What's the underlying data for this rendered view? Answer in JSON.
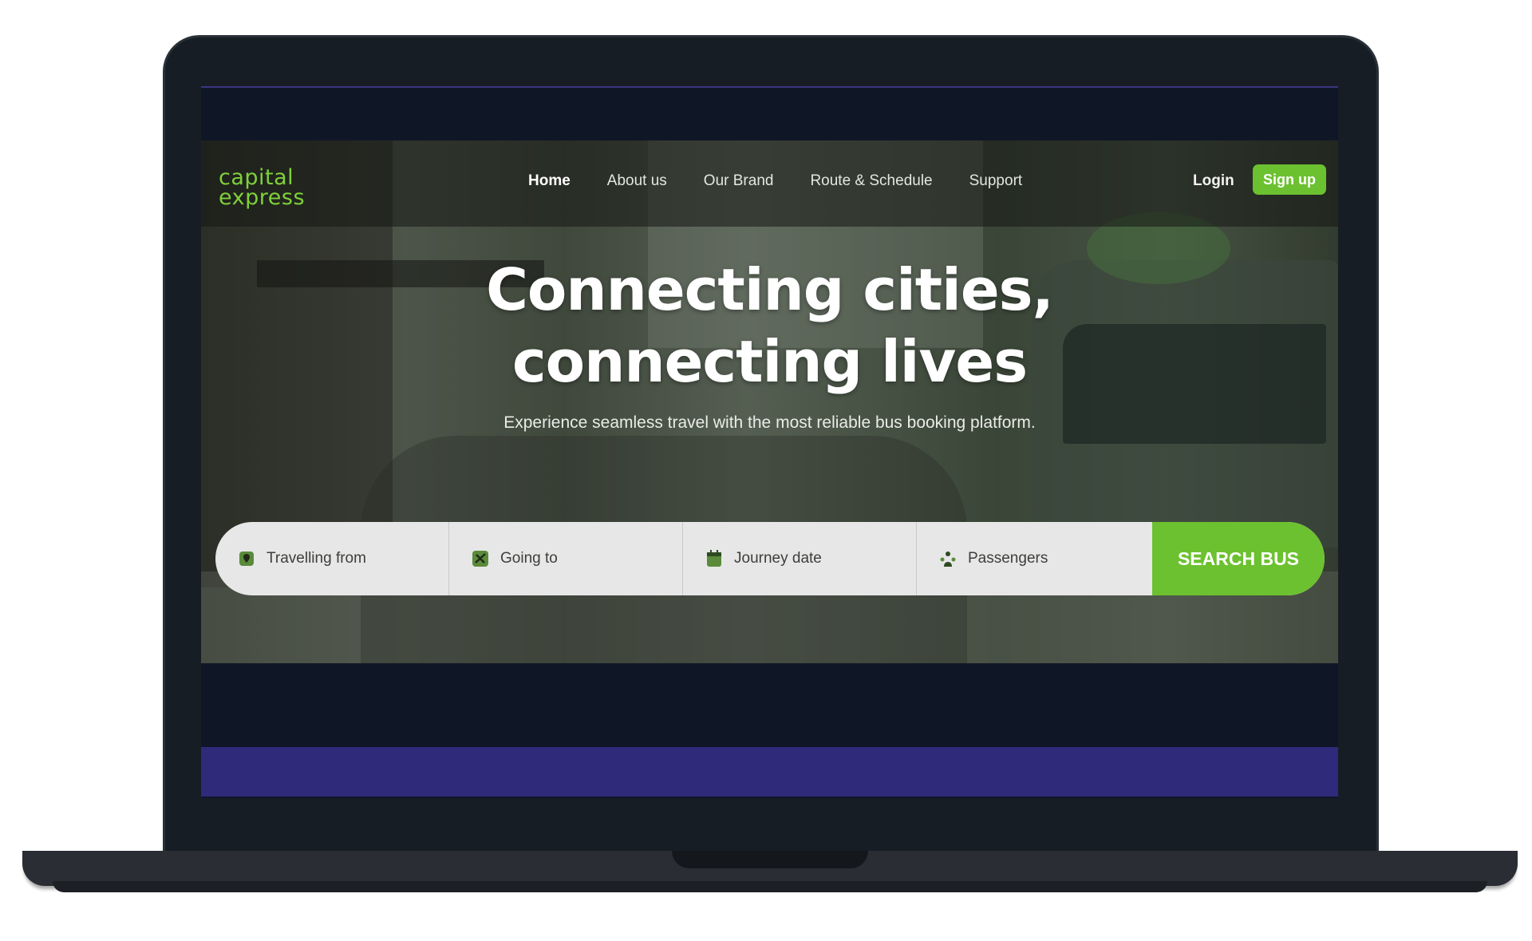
{
  "brand": {
    "logo_line1": "capital",
    "logo_line2": "express",
    "accent_color": "#6cc130"
  },
  "nav": {
    "items": [
      {
        "label": "Home",
        "active": true
      },
      {
        "label": "About us",
        "active": false
      },
      {
        "label": "Our Brand",
        "active": false
      },
      {
        "label": "Route & Schedule",
        "active": false
      },
      {
        "label": "Support",
        "active": false
      }
    ],
    "login_label": "Login",
    "signup_label": "Sign up"
  },
  "hero": {
    "headline_line1": "Connecting cities,",
    "headline_line2": "connecting lives",
    "subheadline": "Experience seamless travel with the most reliable bus booking platform."
  },
  "search": {
    "fields": [
      {
        "label": "Travelling from",
        "icon": "map-pin-icon"
      },
      {
        "label": "Going to",
        "icon": "route-icon"
      },
      {
        "label": "Journey date",
        "icon": "calendar-icon"
      },
      {
        "label": "Passengers",
        "icon": "passengers-icon"
      }
    ],
    "button_label": "SEARCH BUS"
  }
}
